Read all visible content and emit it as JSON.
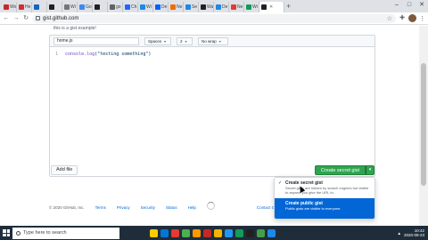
{
  "browser": {
    "tabs": [
      {
        "label": "Wo",
        "color": "#c62828"
      },
      {
        "label": "He",
        "color": "#d32f2f",
        "active": false
      },
      {
        "label": "",
        "color": "#1565c0"
      },
      {
        "label": "",
        "color": "#212121"
      },
      {
        "label": "Wi",
        "color": "#757575"
      },
      {
        "label": "Go",
        "color": "#4285f4"
      },
      {
        "label": "",
        "color": "#212121"
      },
      {
        "label": "go",
        "color": "#5f6368"
      },
      {
        "label": "Ch",
        "color": "#2962ff"
      },
      {
        "label": "Wi",
        "color": "#1e88e5"
      },
      {
        "label": "De",
        "color": "#0061ff"
      },
      {
        "label": "Ne",
        "color": "#ef6c00"
      },
      {
        "label": "Se",
        "color": "#1e88e5"
      },
      {
        "label": "Wa",
        "color": "#212121"
      },
      {
        "label": "De",
        "color": "#1e88e5"
      },
      {
        "label": "Ne",
        "color": "#e53935"
      },
      {
        "label": "Wr",
        "color": "#0f9d58"
      },
      {
        "label": "",
        "color": "#212121",
        "active": true
      }
    ],
    "new_tab": "+",
    "url": "gist.github.com"
  },
  "gist": {
    "description": "this is a gist example!",
    "filename": "home.js",
    "indent_mode": "Spaces",
    "indent_size": "2",
    "wrap_mode": "No wrap",
    "line_number": "1",
    "code_fn": "console.log",
    "code_str": "(\"testing something\")",
    "add_file_label": "Add file",
    "create_label": "Create secret gist",
    "dropdown": {
      "secret_title": "Create secret gist",
      "secret_desc": "Secret gists are hidden by search engines but visible to anyone you give the URL to.",
      "public_title": "Create public gist",
      "public_desc": "Public gists are visible to everyone."
    }
  },
  "footer": {
    "copyright": "© 2020 GitHub, Inc.",
    "links": [
      "Terms",
      "Privacy",
      "Security",
      "Status",
      "Help"
    ],
    "contact": "Contact GitHub"
  },
  "taskbar": {
    "search_placeholder": "Type here to search",
    "time": "10:42",
    "date": "2020-09-23",
    "icon_colors": [
      "#ffcc00",
      "#0078d7",
      "#e53935",
      "#4caf50",
      "#ff9800",
      "#c62828",
      "#f4b400",
      "#2196f3",
      "#0f9d58",
      "#212121",
      "#43a047",
      "#1e88e5"
    ]
  }
}
